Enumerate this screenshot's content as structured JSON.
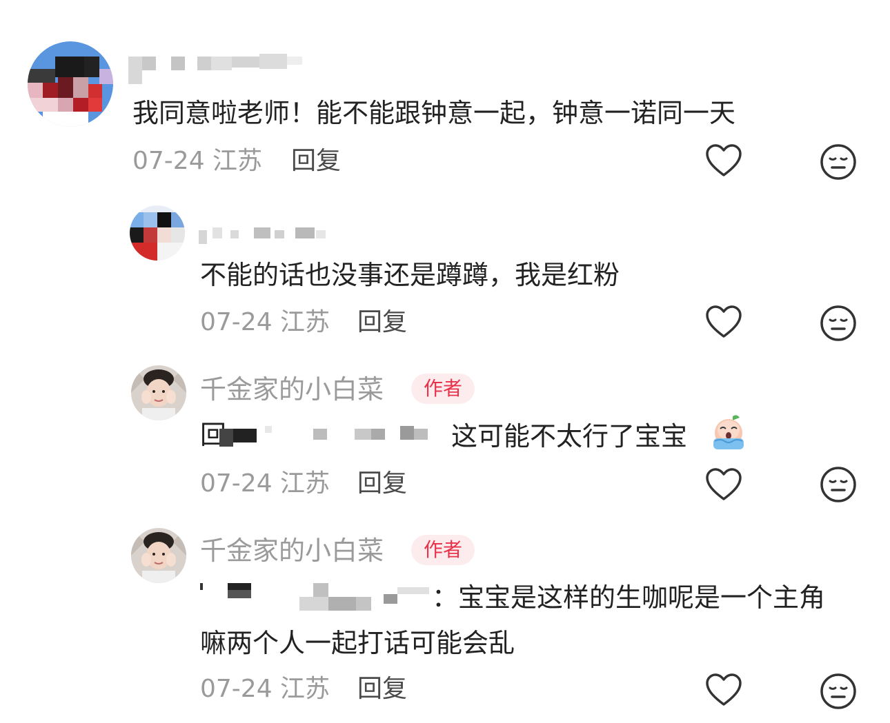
{
  "comments": [
    {
      "name": "",
      "content": "我同意啦老师！能不能跟钟意一起，钟意一诺同一天",
      "date": "07-24 江苏",
      "reply": "回复",
      "author_badge": ""
    },
    {
      "name": "",
      "content": "不能的话也没事还是蹲蹲，我是红粉",
      "date": "07-24 江苏",
      "reply": "回复",
      "author_badge": ""
    },
    {
      "name": "千金家的小白菜",
      "content_prefix": "回复",
      "content": "这可能不太行了宝宝",
      "date": "07-24 江苏",
      "reply": "回复",
      "author_badge": "作者"
    },
    {
      "name": "千金家的小白菜",
      "content_line1": "：宝宝是这样的生咖呢是一个主角",
      "content_line2": "嘛两个人一起打话可能会乱",
      "date": "07-24 江苏",
      "reply": "回复",
      "author_badge": "作者"
    }
  ],
  "icons": {
    "like": "heart-outline-icon",
    "dislike": "meh-face-icon",
    "emoji": "crying-bean-emoji"
  },
  "colors": {
    "badge_bg": "#fdecee",
    "badge_text": "#e8324a",
    "muted_text": "#9a9a9a",
    "body_text": "#222222"
  }
}
